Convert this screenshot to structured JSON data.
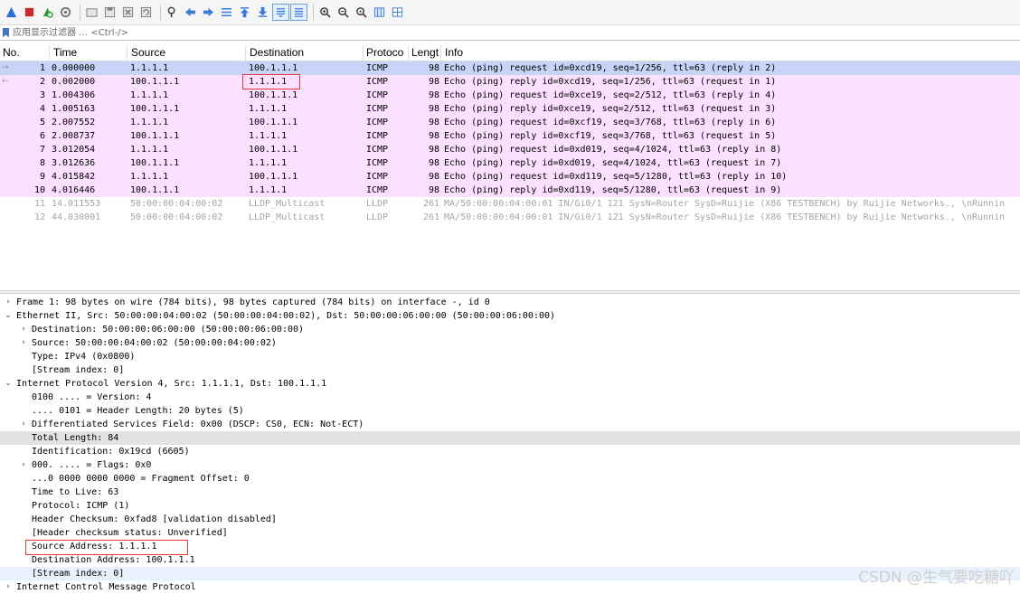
{
  "toolbar": {
    "buttons": [
      {
        "icon": "shark-fin-start-icon",
        "color": "#2a6fd6"
      },
      {
        "icon": "stop-icon",
        "color": "#c92a2a"
      },
      {
        "icon": "restart-icon",
        "color": "#2e9a3a"
      },
      {
        "icon": "capture-options-icon",
        "color": "#777777"
      },
      {
        "sep": true
      },
      {
        "icon": "open-file-icon",
        "color": "#7a7a7a"
      },
      {
        "icon": "save-file-icon",
        "color": "#7a7a7a"
      },
      {
        "icon": "close-file-icon",
        "color": "#7a7a7a"
      },
      {
        "icon": "reload-icon",
        "color": "#7a7a7a"
      },
      {
        "sep": true
      },
      {
        "icon": "find-packet-icon",
        "color": "#444444"
      },
      {
        "icon": "go-back-icon",
        "color": "#3a7bd5"
      },
      {
        "icon": "go-forward-icon",
        "color": "#3a7bd5"
      },
      {
        "icon": "go-to-packet-icon",
        "color": "#3a7bd5"
      },
      {
        "icon": "go-first-icon",
        "color": "#3a7bd5"
      },
      {
        "icon": "go-last-icon",
        "color": "#3a7bd5"
      },
      {
        "icon": "auto-scroll-icon",
        "color": "#3a7bd5",
        "active": true
      },
      {
        "icon": "colorize-icon",
        "color": "#3a7bd5",
        "active": true
      },
      {
        "sep": true
      },
      {
        "icon": "zoom-in-icon",
        "color": "#444444"
      },
      {
        "icon": "zoom-out-icon",
        "color": "#444444"
      },
      {
        "icon": "zoom-normal-icon",
        "color": "#444444"
      },
      {
        "icon": "resize-columns-icon",
        "color": "#3a7bd5"
      },
      {
        "icon": "grid-icon",
        "color": "#3a7bd5"
      }
    ]
  },
  "filter": {
    "placeholder": "应用显示过滤器 … <Ctrl-/>"
  },
  "packet_list": {
    "columns": [
      "No.",
      "Time",
      "Source",
      "Destination",
      "Protoco",
      "Lengt",
      "Info"
    ],
    "rows": [
      {
        "no": "1",
        "time": "0.000000",
        "src": "1.1.1.1",
        "dst": "100.1.1.1",
        "proto": "ICMP",
        "len": "98",
        "info": "Echo (ping) request  id=0xcd19, seq=1/256, ttl=63 (reply in 2)",
        "arrow": "→",
        "kind": "selected"
      },
      {
        "no": "2",
        "time": "0.002000",
        "src": "100.1.1.1",
        "dst": "1.1.1.1",
        "proto": "ICMP",
        "len": "98",
        "info": "Echo (ping) reply    id=0xcd19, seq=1/256, ttl=63 (request in 1)",
        "arrow": "←",
        "kind": "icmp"
      },
      {
        "no": "3",
        "time": "1.004306",
        "src": "1.1.1.1",
        "dst": "100.1.1.1",
        "proto": "ICMP",
        "len": "98",
        "info": "Echo (ping) request  id=0xce19, seq=2/512, ttl=63 (reply in 4)",
        "arrow": "",
        "kind": "icmp"
      },
      {
        "no": "4",
        "time": "1.005163",
        "src": "100.1.1.1",
        "dst": "1.1.1.1",
        "proto": "ICMP",
        "len": "98",
        "info": "Echo (ping) reply    id=0xce19, seq=2/512, ttl=63 (request in 3)",
        "arrow": "",
        "kind": "icmp"
      },
      {
        "no": "5",
        "time": "2.007552",
        "src": "1.1.1.1",
        "dst": "100.1.1.1",
        "proto": "ICMP",
        "len": "98",
        "info": "Echo (ping) request  id=0xcf19, seq=3/768, ttl=63 (reply in 6)",
        "arrow": "",
        "kind": "icmp"
      },
      {
        "no": "6",
        "time": "2.008737",
        "src": "100.1.1.1",
        "dst": "1.1.1.1",
        "proto": "ICMP",
        "len": "98",
        "info": "Echo (ping) reply    id=0xcf19, seq=3/768, ttl=63 (request in 5)",
        "arrow": "",
        "kind": "icmp"
      },
      {
        "no": "7",
        "time": "3.012054",
        "src": "1.1.1.1",
        "dst": "100.1.1.1",
        "proto": "ICMP",
        "len": "98",
        "info": "Echo (ping) request  id=0xd019, seq=4/1024, ttl=63 (reply in 8)",
        "arrow": "",
        "kind": "icmp"
      },
      {
        "no": "8",
        "time": "3.012636",
        "src": "100.1.1.1",
        "dst": "1.1.1.1",
        "proto": "ICMP",
        "len": "98",
        "info": "Echo (ping) reply    id=0xd019, seq=4/1024, ttl=63 (request in 7)",
        "arrow": "",
        "kind": "icmp"
      },
      {
        "no": "9",
        "time": "4.015842",
        "src": "1.1.1.1",
        "dst": "100.1.1.1",
        "proto": "ICMP",
        "len": "98",
        "info": "Echo (ping) request  id=0xd119, seq=5/1280, ttl=63 (reply in 10)",
        "arrow": "",
        "kind": "icmp"
      },
      {
        "no": "10",
        "time": "4.016446",
        "src": "100.1.1.1",
        "dst": "1.1.1.1",
        "proto": "ICMP",
        "len": "98",
        "info": "Echo (ping) reply    id=0xd119, seq=5/1280, ttl=63 (request in 9)",
        "arrow": "",
        "kind": "icmp"
      },
      {
        "no": "11",
        "time": "14.011553",
        "src": "50:00:00:04:00:02",
        "dst": "LLDP_Multicast",
        "proto": "LLDP",
        "len": "261",
        "info": "MA/50:00:00:04:00:01 IN/Gi0/1 121 SysN=Router SysD=Ruijie (X86 TESTBENCH) by Ruijie Networks., \\nRunnin",
        "arrow": "",
        "kind": "lldp"
      },
      {
        "no": "12",
        "time": "44.030001",
        "src": "50:00:00:04:00:02",
        "dst": "LLDP_Multicast",
        "proto": "LLDP",
        "len": "261",
        "info": "MA/50:00:00:04:00:01 IN/Gi0/1 121 SysN=Router SysD=Ruijie (X86 TESTBENCH) by Ruijie Networks., \\nRunnin",
        "arrow": "",
        "kind": "lldp"
      }
    ]
  },
  "details": [
    {
      "indent": 0,
      "twisty": ">",
      "text": "Frame 1: 98 bytes on wire (784 bits), 98 bytes captured (784 bits) on interface -, id 0"
    },
    {
      "indent": 0,
      "twisty": "v",
      "text": "Ethernet II, Src: 50:00:00:04:00:02 (50:00:00:04:00:02), Dst: 50:00:00:06:00:00 (50:00:00:06:00:00)"
    },
    {
      "indent": 1,
      "twisty": ">",
      "text": "Destination: 50:00:00:06:00:00 (50:00:00:06:00:00)"
    },
    {
      "indent": 1,
      "twisty": ">",
      "text": "Source: 50:00:00:04:00:02 (50:00:00:04:00:02)"
    },
    {
      "indent": 1,
      "twisty": "",
      "text": "Type: IPv4 (0x0800)"
    },
    {
      "indent": 1,
      "twisty": "",
      "text": "[Stream index: 0]"
    },
    {
      "indent": 0,
      "twisty": "v",
      "text": "Internet Protocol Version 4, Src: 1.1.1.1, Dst: 100.1.1.1"
    },
    {
      "indent": 1,
      "twisty": "",
      "text": "0100 .... = Version: 4"
    },
    {
      "indent": 1,
      "twisty": "",
      "text": ".... 0101 = Header Length: 20 bytes (5)"
    },
    {
      "indent": 1,
      "twisty": ">",
      "text": "Differentiated Services Field: 0x00 (DSCP: CS0, ECN: Not-ECT)"
    },
    {
      "indent": 1,
      "twisty": "",
      "text": "Total Length: 84",
      "state": "sel"
    },
    {
      "indent": 1,
      "twisty": "",
      "text": "Identification: 0x19cd (6605)"
    },
    {
      "indent": 1,
      "twisty": ">",
      "text": "000. .... = Flags: 0x0"
    },
    {
      "indent": 1,
      "twisty": "",
      "text": "...0 0000 0000 0000 = Fragment Offset: 0"
    },
    {
      "indent": 1,
      "twisty": "",
      "text": "Time to Live: 63"
    },
    {
      "indent": 1,
      "twisty": "",
      "text": "Protocol: ICMP (1)"
    },
    {
      "indent": 1,
      "twisty": "",
      "text": "Header Checksum: 0xfad8 [validation disabled]"
    },
    {
      "indent": 1,
      "twisty": "",
      "text": "[Header checksum status: Unverified]"
    },
    {
      "indent": 1,
      "twisty": "",
      "text": "Source Address: 1.1.1.1"
    },
    {
      "indent": 1,
      "twisty": "",
      "text": "Destination Address: 100.1.1.1"
    },
    {
      "indent": 1,
      "twisty": "",
      "text": "[Stream index: 0]",
      "state": "hover"
    },
    {
      "indent": 0,
      "twisty": ">",
      "text": "Internet Control Message Protocol"
    }
  ],
  "watermark": "CSDN @生气要吃糖吖",
  "colors": {
    "icmp_row": "#fce0ff",
    "selected_row": "#c7d4f7",
    "annotation": "#e63a3a"
  }
}
